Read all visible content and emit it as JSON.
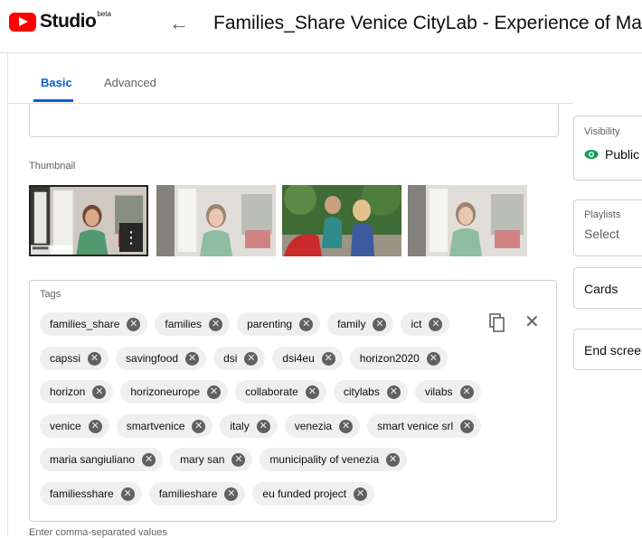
{
  "header": {
    "brand": "Studio",
    "badge": "beta",
    "back_icon": "arrow-left-icon",
    "title": "Families_Share Venice CityLab - Experience of Maria!"
  },
  "tabs": [
    {
      "label": "Basic",
      "active": true
    },
    {
      "label": "Advanced",
      "active": false
    }
  ],
  "thumbnail": {
    "label": "Thumbnail",
    "selected_index": 0
  },
  "tags": {
    "label": "Tags",
    "hint": "Enter comma-separated values",
    "items": [
      "families_share",
      "families",
      "parenting",
      "family",
      "ict",
      "capssi",
      "savingfood",
      "dsi",
      "dsi4eu",
      "horizon2020",
      "horizon",
      "horizoneurope",
      "collaborate",
      "citylabs",
      "vilabs",
      "venice",
      "smartvenice",
      "italy",
      "venezia",
      "smart venice srl",
      "maria sangiuliano",
      "mary san",
      "municipality of venezia",
      "familiesshare",
      "familieshare",
      "eu funded project"
    ]
  },
  "side_panel": {
    "visibility_label": "Visibility",
    "visibility_value": "Public",
    "playlists_label": "Playlists",
    "playlists_value": "Select",
    "cards_label": "Cards",
    "end_screen_label": "End screen"
  },
  "colors": {
    "accent": "#065fd4",
    "brand_red": "#ff0000",
    "public_green": "#0f9d58",
    "chip_bg": "#efefef"
  }
}
